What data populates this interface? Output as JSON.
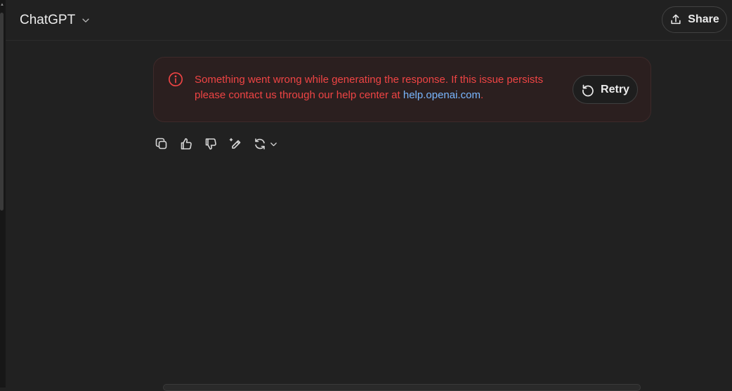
{
  "header": {
    "model_name": "ChatGPT",
    "share_label": "Share"
  },
  "error": {
    "message": "Something went wrong while generating the response. If this issue persists please contact us through our help center at ",
    "link_text": "help.openai.com",
    "suffix": ".",
    "retry_label": "Retry"
  },
  "message_actions": [
    {
      "name": "copy",
      "icon": "copy-icon"
    },
    {
      "name": "good-response",
      "icon": "thumbs-up-icon"
    },
    {
      "name": "bad-response",
      "icon": "thumbs-down-icon"
    },
    {
      "name": "edit-in-canvas",
      "icon": "edit-sparkle-icon"
    },
    {
      "name": "regenerate",
      "icon": "regenerate-icon"
    }
  ],
  "colors": {
    "background": "#212121",
    "error_text": "#ef4444",
    "link": "#7ab7ff",
    "error_bg": "#2b1f1f"
  }
}
